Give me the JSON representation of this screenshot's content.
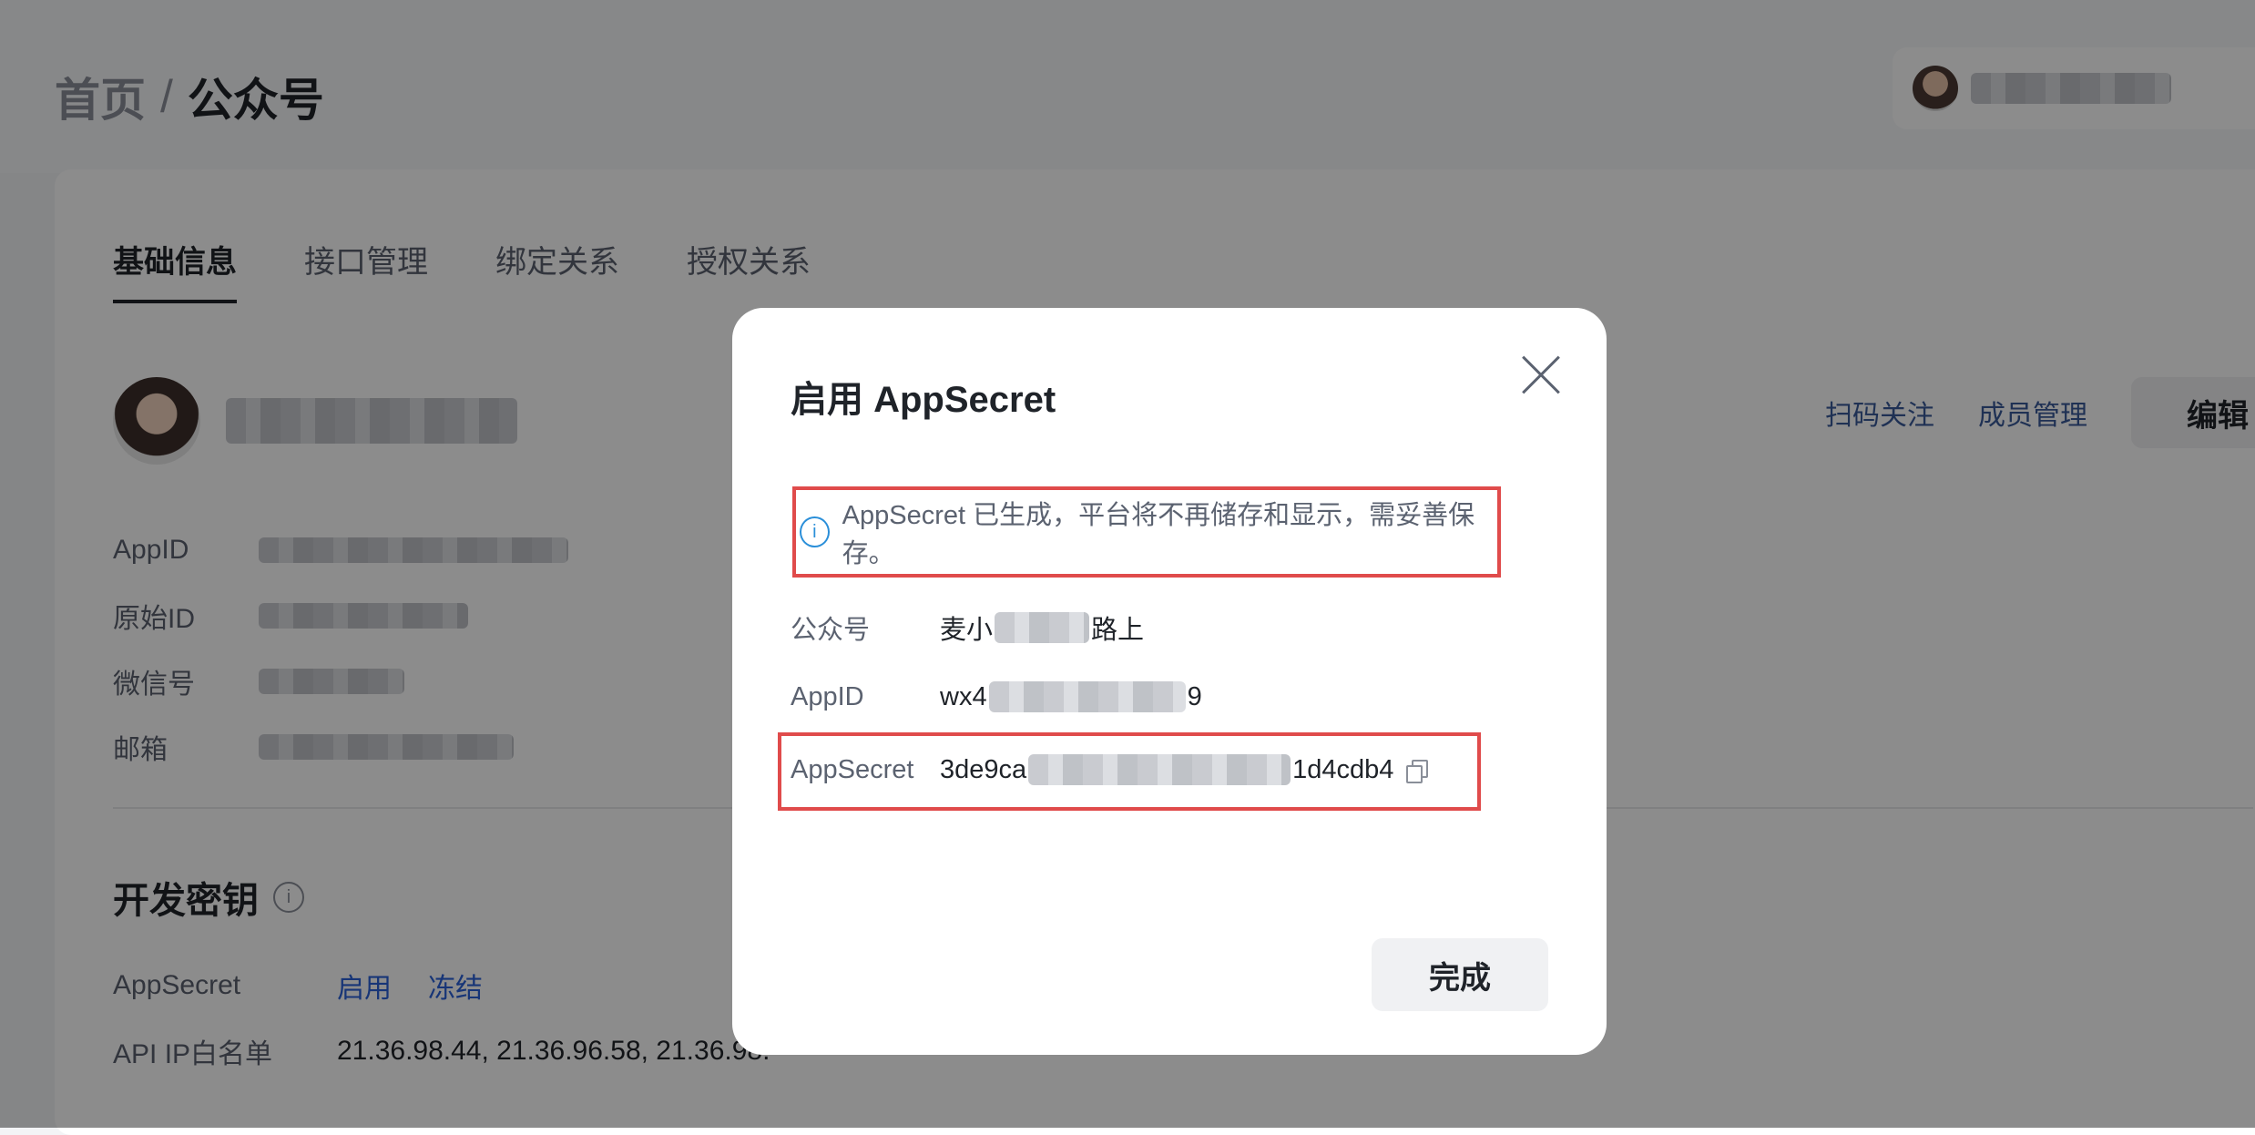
{
  "breadcrumb": {
    "home": "首页",
    "separator": "/",
    "current": "公众号"
  },
  "tabs": [
    {
      "label": "基础信息",
      "active": true
    },
    {
      "label": "接口管理",
      "active": false
    },
    {
      "label": "绑定关系",
      "active": false
    },
    {
      "label": "授权关系",
      "active": false
    }
  ],
  "profile_actions": {
    "scan_follow": "扫码关注",
    "member_manage": "成员管理",
    "edit": "编辑"
  },
  "info_labels": {
    "appid": "AppID",
    "original_id": "原始ID",
    "wechat_id": "微信号",
    "email": "邮箱"
  },
  "dev_keys": {
    "title": "开发密钥",
    "appsecret_label": "AppSecret",
    "enable": "启用",
    "freeze": "冻结",
    "ip_whitelist_label": "API IP白名单",
    "ip_whitelist_value": "21.36.98.44, 21.36.96.58, 21.36.98."
  },
  "modal": {
    "title": "启用 AppSecret",
    "notice": "AppSecret 已生成，平台将不再储存和显示，需妥善保存。",
    "account_label": "公众号",
    "account_prefix": "麦小",
    "account_suffix": "路上",
    "appid_label": "AppID",
    "appid_prefix": "wx4",
    "appid_suffix": "9",
    "secret_label": "AppSecret",
    "secret_prefix": "3de9ca",
    "secret_suffix": "1d4cdb4",
    "done": "完成"
  },
  "colors": {
    "accent_link": "#2b62d9",
    "highlight_border": "#e04b4b",
    "info_icon": "#2b8fd9"
  },
  "icons": {
    "close": "close-icon",
    "info": "info-circle-icon",
    "copy": "copy-icon",
    "dropdown": "chevron-down-icon"
  }
}
